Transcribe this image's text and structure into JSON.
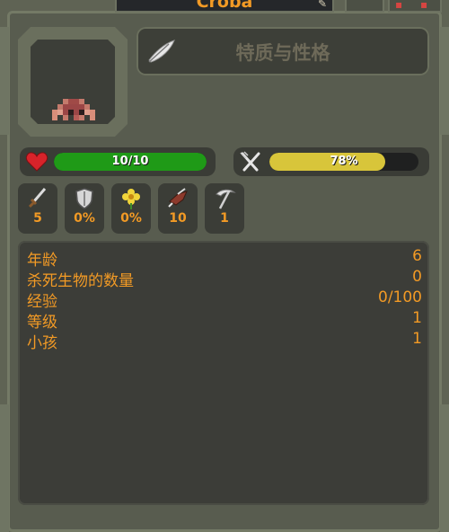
{
  "header": {
    "name": "Croba",
    "edit_icon": "edit-icon",
    "close_icon": "close-icon"
  },
  "portrait": {
    "icon": "crab-sprite"
  },
  "traits_button": {
    "label": "特质与性格",
    "icon": "feather-icon"
  },
  "health": {
    "text": "10/10",
    "fraction": 1.0,
    "color": "#1f9a17",
    "icon": "heart-icon"
  },
  "food": {
    "text": "78%",
    "fraction": 0.78,
    "color": "#d8c53a",
    "icon": "fork-knife-icon"
  },
  "stats": [
    {
      "icon": "sword-icon",
      "value": "5"
    },
    {
      "icon": "shield-icon",
      "value": "0%"
    },
    {
      "icon": "flower-icon",
      "value": "0%"
    },
    {
      "icon": "bird-icon",
      "value": "10"
    },
    {
      "icon": "scythe-icon",
      "value": "1"
    }
  ],
  "info": [
    {
      "key": "年龄",
      "value": "6"
    },
    {
      "key": "杀死生物的数量",
      "value": "0"
    },
    {
      "key": "经验",
      "value": "0/100"
    },
    {
      "key": "等级",
      "value": "1"
    },
    {
      "key": "小孩",
      "value": "1"
    }
  ],
  "colors": {
    "accent": "#f29a25",
    "panel": "#3c3d38",
    "frame": "#585c4f"
  }
}
